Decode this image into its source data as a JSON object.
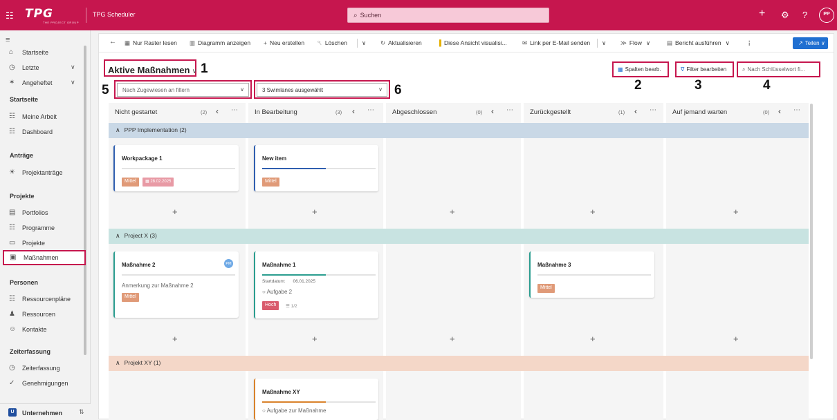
{
  "topbar": {
    "logo": "TPG",
    "logo_sub": "THE PROJECT GROUP",
    "app_name": "TPG Scheduler",
    "search_placeholder": "Suchen",
    "help": "?",
    "avatar": "PP"
  },
  "sidebar": {
    "items": [
      {
        "label": "Startseite"
      },
      {
        "label": "Letzte"
      },
      {
        "label": "Angeheftet"
      }
    ],
    "sections": [
      {
        "title": "Startseite",
        "items": [
          "Meine Arbeit",
          "Dashboard"
        ]
      },
      {
        "title": "Anträge",
        "items": [
          "Projektanträge"
        ]
      },
      {
        "title": "Projekte",
        "items": [
          "Portfolios",
          "Programme",
          "Projekte",
          "Maßnahmen"
        ]
      },
      {
        "title": "Personen",
        "items": [
          "Ressourcenpläne",
          "Ressourcen",
          "Kontakte"
        ]
      },
      {
        "title": "Zeiterfassung",
        "items": [
          "Zeiterfassung",
          "Genehmigungen"
        ]
      }
    ],
    "company_badge": "U",
    "company": "Unternehmen"
  },
  "commands": {
    "read_grid": "Nur Raster lesen",
    "show_chart": "Diagramm anzeigen",
    "new": "Neu erstellen",
    "delete": "Löschen",
    "refresh": "Aktualisieren",
    "visualize": "Diese Ansicht visualisi...",
    "email_link": "Link per E-Mail senden",
    "flow": "Flow",
    "report": "Bericht ausführen",
    "share": "Teilen"
  },
  "view": {
    "title": "Aktive Maßnahmen",
    "edit_columns": "Spalten bearb.",
    "edit_filter": "Filter bearbeiten",
    "keyword_search_placeholder": "Nach Schlüsselwort fi...",
    "assignee_filter_placeholder": "Nach Zugewiesen an filtern",
    "swimlane_filter": "3 Swimlanes ausgewählt"
  },
  "callouts": [
    "1",
    "2",
    "3",
    "4",
    "5",
    "6"
  ],
  "columns": [
    {
      "name": "Nicht gestartet",
      "count": "(2)"
    },
    {
      "name": "In Bearbeitung",
      "count": "(3)"
    },
    {
      "name": "Abgeschlossen",
      "count": "(0)"
    },
    {
      "name": "Zurückgestellt",
      "count": "(1)"
    },
    {
      "name": "Auf jemand warten",
      "count": "(0)"
    }
  ],
  "swimlanes": [
    {
      "name": "PPP Implementation",
      "count": "(2)",
      "color": "#c9d8e6"
    },
    {
      "name": "Project X",
      "count": "(3)",
      "color": "#c8e3e1"
    },
    {
      "name": "Projekt XY",
      "count": "(1)",
      "color": "#f4d7c8"
    }
  ],
  "cards": {
    "wp1": {
      "title": "Workpackage 1",
      "priority": "Mittel",
      "date": "28.02.2025"
    },
    "new_item": {
      "title": "New item",
      "priority": "Mittel"
    },
    "m2": {
      "title": "Maßnahme 2",
      "avatar": "PM",
      "note": "Anmerkung zur Maßnahme 2",
      "priority": "Mittel"
    },
    "m1": {
      "title": "Maßnahme 1",
      "start_label": "Startdatum:",
      "start_date": "06.01.2025",
      "task": "Aufgabe 2",
      "priority": "Hoch",
      "checklist": "1/2"
    },
    "m3": {
      "title": "Maßnahme 3",
      "priority": "Mittel"
    },
    "mxy": {
      "title": "Maßnahme XY",
      "task": "Aufgabe zur Maßnahme"
    }
  },
  "colors": {
    "brand": "#c6164e",
    "accent": "#1f6fd1",
    "priority_medium": "#e09a78",
    "priority_high": "#d95c6d"
  },
  "icons": [
    "waffle-icon",
    "search-icon",
    "plus-icon",
    "gear-icon",
    "help-icon",
    "home-icon",
    "clock-icon",
    "pin-icon",
    "chevron-down-icon",
    "board-icon",
    "lightbulb-icon",
    "portfolio-icon",
    "program-icon",
    "project-icon",
    "action-icon",
    "resource-icon",
    "person-icon",
    "contact-icon",
    "time-icon",
    "check-icon",
    "back-icon",
    "grid-icon",
    "chart-icon",
    "trash-icon",
    "refresh-icon",
    "powerbi-icon",
    "email-icon",
    "flow-icon",
    "report-icon",
    "share-icon",
    "columns-icon",
    "filter-icon",
    "arrow-left-icon",
    "more-icon"
  ]
}
